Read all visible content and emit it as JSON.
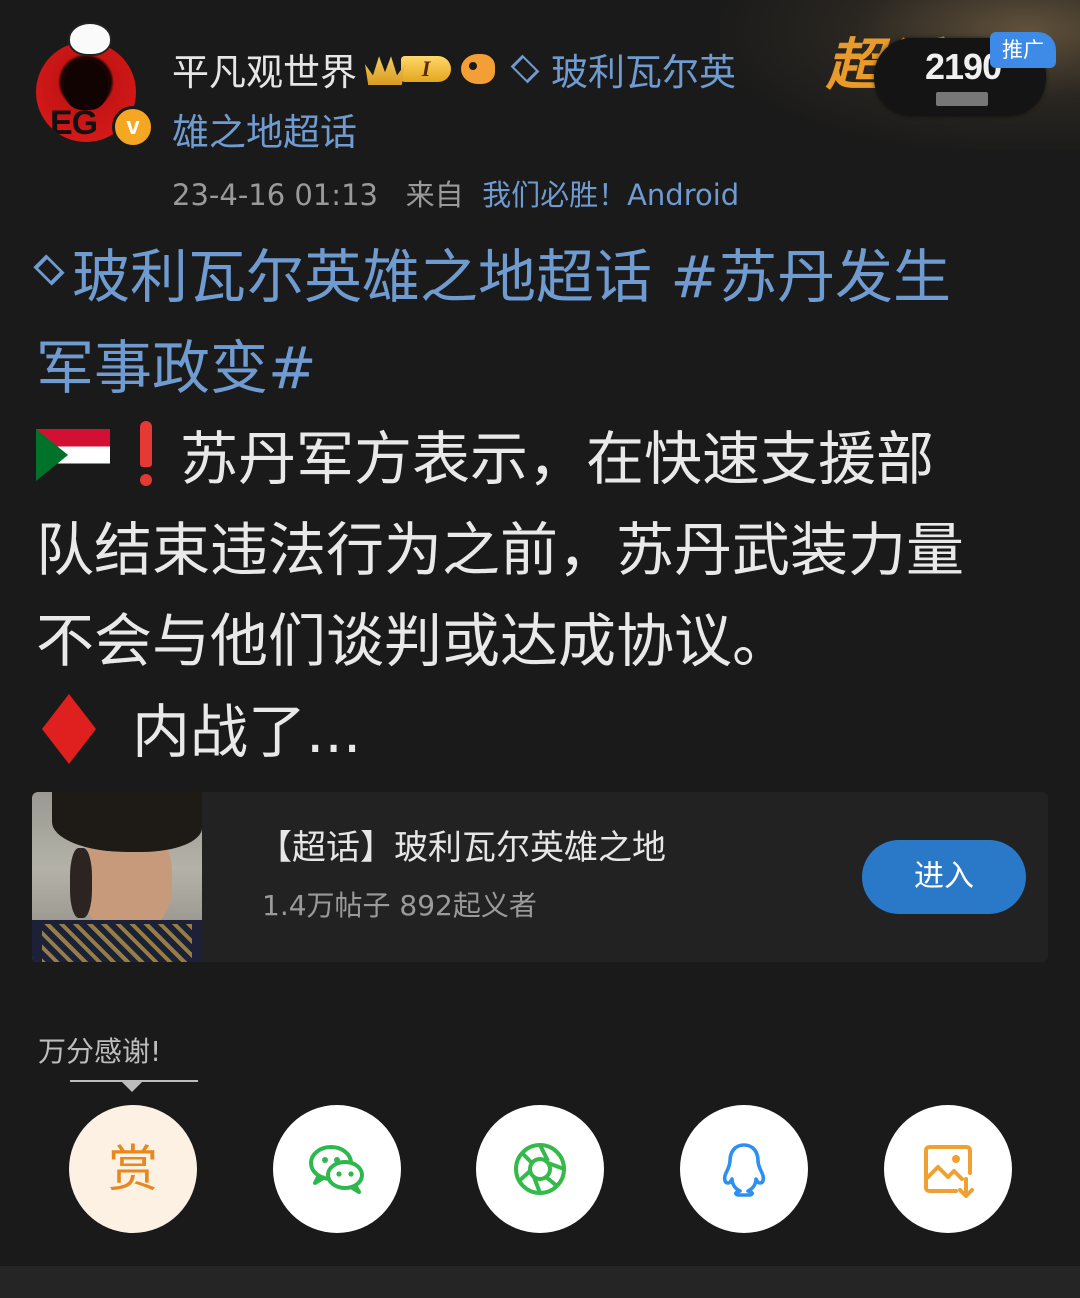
{
  "post": {
    "author": "平凡观世界",
    "level_badge": "I",
    "topic_line1": "玻利瓦尔英",
    "topic_line2": "雄之地超话",
    "timestamp": "23-4-16 01:13",
    "from_label": "来自",
    "source": "我们必胜！Android",
    "body": {
      "hashtag_line1": "玻利瓦尔英雄之地超话 #苏丹发生",
      "hashtag_line2": "军事政变#",
      "line3": "苏丹军方表示，在快速支援部",
      "line4": "队结束违法行为之前，苏丹武装力量",
      "line5": "不会与他们谈判或达成协议。",
      "line6": "内战了..."
    },
    "icons": [
      "sudan-flag-icon",
      "exclamation-icon",
      "red-diamond-icon"
    ]
  },
  "promo": {
    "logo": "超话",
    "count": "2190",
    "tag": "推广"
  },
  "topic_card": {
    "title": "【超话】玻利瓦尔英雄之地",
    "stats": "1.4万帖子  892起义者",
    "enter_label": "进入"
  },
  "share": {
    "thanks": "万分感谢!",
    "reward_label": "赏",
    "buttons": [
      "reward",
      "wechat-icon",
      "moments-icon",
      "qq-icon",
      "save-image-icon"
    ]
  },
  "colors": {
    "background": "#1a1a1a",
    "link": "#6f9bd1",
    "accent": "#2a79c9",
    "reward": "#e8871e"
  }
}
